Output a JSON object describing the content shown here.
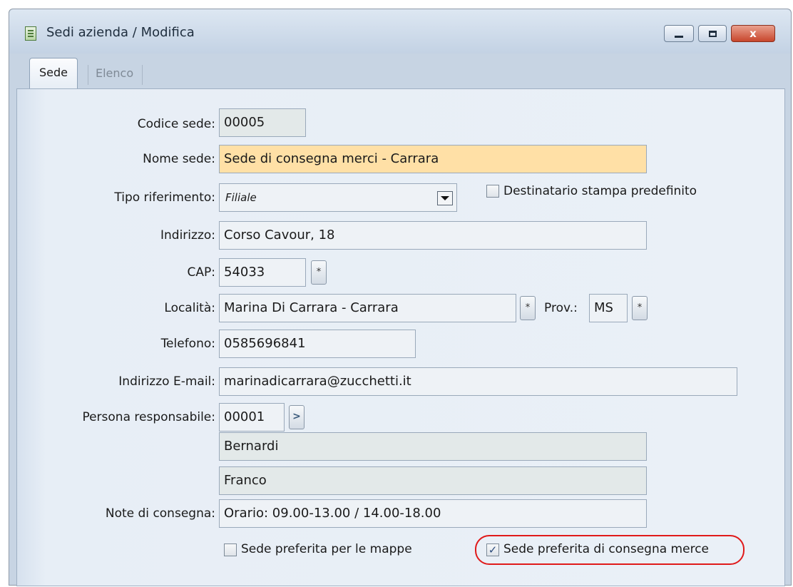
{
  "window": {
    "title": "Sedi azienda / Modifica",
    "icon": "form-icon",
    "controls": {
      "minimize": "minimize-icon",
      "maximize": "maximize-icon",
      "close_label": "x"
    }
  },
  "tabs": [
    {
      "label": "Sede",
      "active": true
    },
    {
      "label": "Elenco",
      "active": false
    }
  ],
  "form": {
    "codice_sede": {
      "label": "Codice sede:",
      "value": "00005"
    },
    "nome_sede": {
      "label": "Nome sede:",
      "value": "Sede di consegna merci - Carrara"
    },
    "tipo_riferimento": {
      "label": "Tipo riferimento:",
      "value": "Filiale"
    },
    "destinatario": {
      "label": "Destinatario stampa predefinito",
      "checked": false
    },
    "indirizzo": {
      "label": "Indirizzo:",
      "value": "Corso Cavour, 18"
    },
    "cap": {
      "label": "CAP:",
      "value": "54033"
    },
    "localita": {
      "label": "Località:",
      "value": "Marina Di Carrara - Carrara"
    },
    "prov": {
      "label": "Prov.:",
      "value": "MS"
    },
    "telefono": {
      "label": "Telefono:",
      "value": "0585696841"
    },
    "email": {
      "label": "Indirizzo E-mail:",
      "value": "marinadicarrara@zucchetti.it"
    },
    "responsabile": {
      "label": "Persona responsabile:",
      "code": "00001",
      "cognome": "Bernardi",
      "nome": "Franco"
    },
    "note": {
      "label": "Note di consegna:",
      "value": "Orario: 09.00-13.00 / 14.00-18.00"
    },
    "pref_mappe": {
      "label": "Sede preferita per le mappe",
      "checked": false
    },
    "pref_consegna": {
      "label": "Sede preferita di consegna merce",
      "checked": true
    }
  },
  "glyphs": {
    "zoom": "*",
    "link": ">",
    "check": "✓"
  },
  "colors": {
    "required_bg": "#ffe0a6",
    "highlight": "#e01a1a"
  }
}
